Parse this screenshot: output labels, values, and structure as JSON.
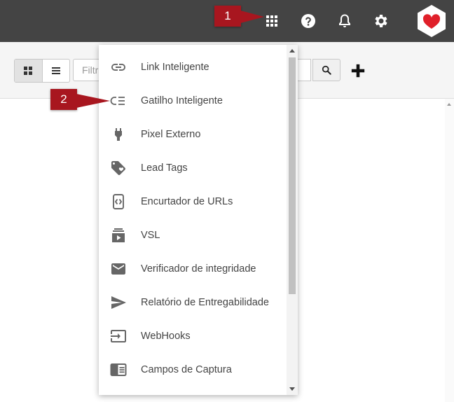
{
  "topbar": {
    "icons": [
      "apps-grid-icon",
      "help-icon",
      "bell-icon",
      "gear-icon",
      "heart-logo"
    ],
    "background": "#444444"
  },
  "callouts": [
    {
      "label": "1"
    },
    {
      "label": "2"
    }
  ],
  "toolbar": {
    "filter_placeholder": "Filtrar",
    "view_modes": [
      "grid",
      "list"
    ]
  },
  "menu": {
    "items": [
      {
        "label": "Link Inteligente",
        "icon": "link-icon"
      },
      {
        "label": "Gatilho Inteligente",
        "icon": "trigger-icon"
      },
      {
        "label": "Pixel Externo",
        "icon": "plug-icon"
      },
      {
        "label": "Lead Tags",
        "icon": "tag-icon"
      },
      {
        "label": "Encurtador de URLs",
        "icon": "shortener-icon"
      },
      {
        "label": "VSL",
        "icon": "video-library-icon"
      },
      {
        "label": "Verificador de integridade",
        "icon": "mail-icon"
      },
      {
        "label": "Relatório de Entregabilidade",
        "icon": "send-icon"
      },
      {
        "label": "WebHooks",
        "icon": "input-icon"
      },
      {
        "label": "Campos de Captura",
        "icon": "form-icon"
      }
    ]
  },
  "colors": {
    "callout": "#a8161f",
    "logo_heart": "#e0202a"
  }
}
